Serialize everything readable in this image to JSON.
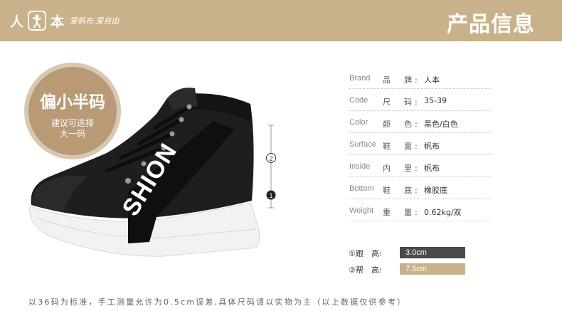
{
  "header": {
    "brand_char_1": "人",
    "brand_char_2": "本",
    "slogan": "爱帆布.爱自由",
    "title": "产品信息",
    "background_color": "#c9b28a"
  },
  "badge": {
    "title": "偏小半码",
    "subtitle": "建议可选择\n大一码",
    "color": "#b89a74"
  },
  "shoe_print": "SHION",
  "scale_markers": [
    "2",
    "1"
  ],
  "specs": [
    {
      "en": "Brand",
      "cn": "品　牌:",
      "value": "人本"
    },
    {
      "en": "Code",
      "cn": "尺　码:",
      "value": "35-39"
    },
    {
      "en": "Color",
      "cn": "颜　色:",
      "value": "黑色/白色"
    },
    {
      "en": "Surface",
      "cn": "鞋　面:",
      "value": "帆布"
    },
    {
      "en": "Inside",
      "cn": "内　里:",
      "value": "帆布"
    },
    {
      "en": "Bottom",
      "cn": "鞋　底:",
      "value": "橡胶底"
    },
    {
      "en": "Weight",
      "cn": "重　量:",
      "value": "0.62kg/双"
    }
  ],
  "measurements": [
    {
      "label": "①跟　高:",
      "value": "3.0cm",
      "color": "#4a4a4a"
    },
    {
      "label": "②帮　高:",
      "value": "7.5cm",
      "color": "#c9b28a"
    }
  ],
  "footnote": "以36码为标准，手工测量允许为0.5cm误差,具体尺码请以实物为主（以上数据仅供参考）"
}
